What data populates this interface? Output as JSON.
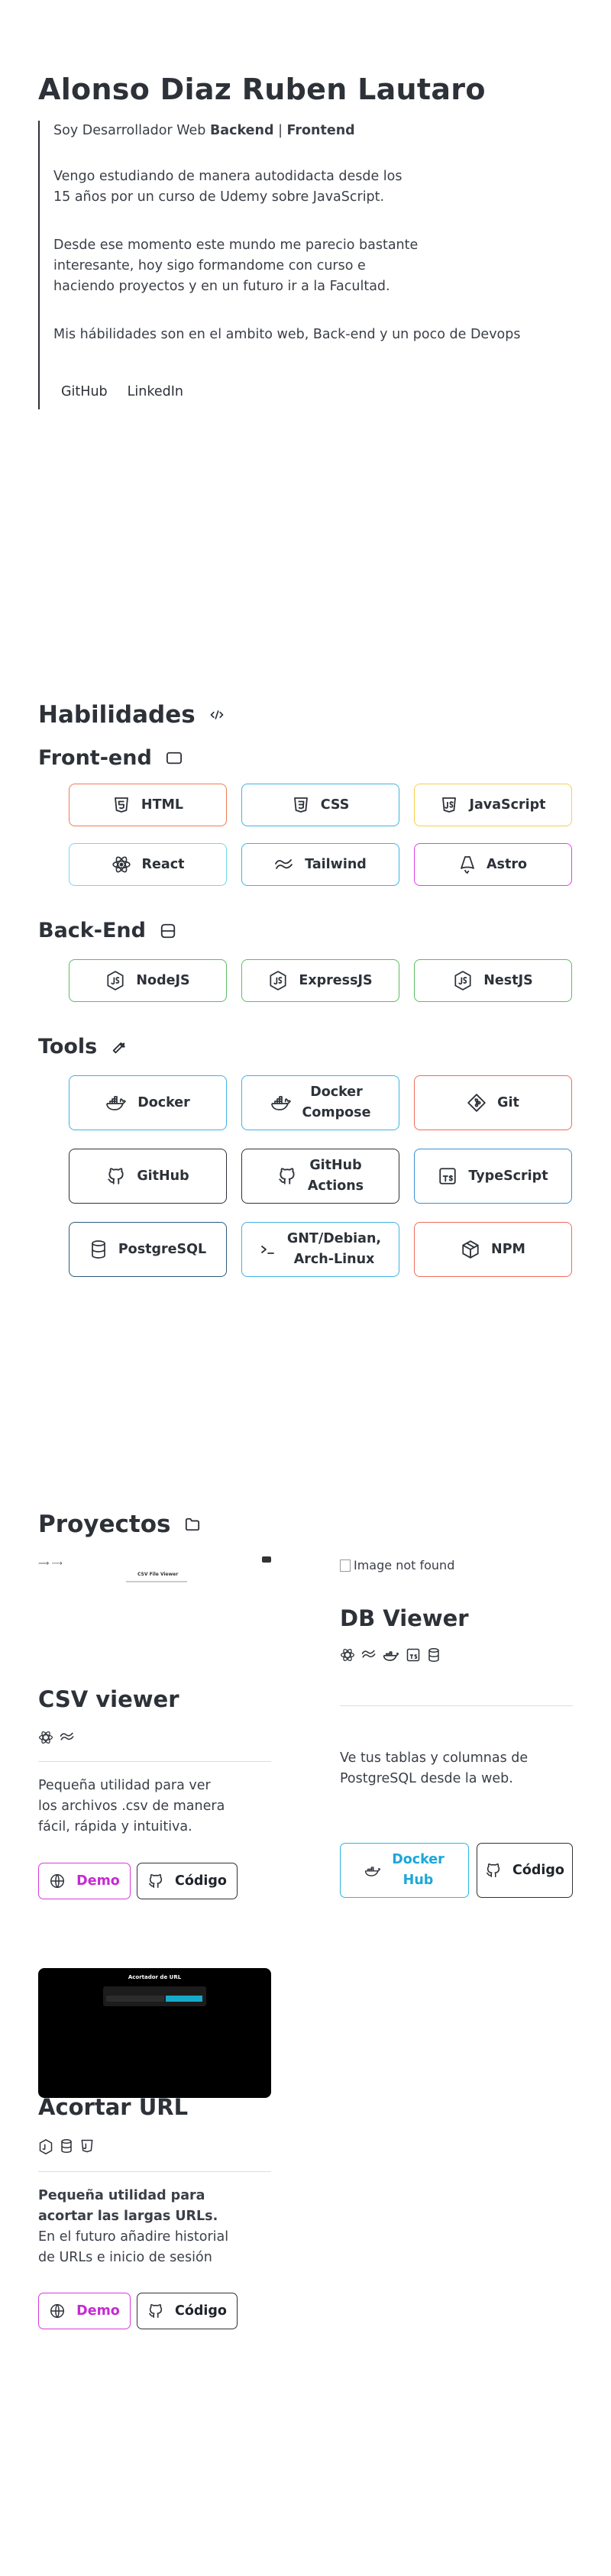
{
  "hero": {
    "name": "Alonso Diaz Ruben Lautaro",
    "intro_prefix": "Soy Desarrollador Web ",
    "intro_backend": "Backend",
    "intro_sep": " | ",
    "intro_frontend": "Frontend",
    "p1_line1": "Vengo estudiando de manera autodidacta desde los",
    "p1_line2": "15 años por un curso de Udemy sobre JavaScript.",
    "p2_line1": "Desde ese momento este mundo me parecio bastante",
    "p2_line2": "interesante, hoy sigo formandome con curso e",
    "p2_line3": "haciendo proyectos y en un futuro ir a la Facultad.",
    "p3": "Mis hábilidades son en el ambito web, Back-end y un poco de Devops",
    "link_github": "GitHub",
    "link_linkedin": "LinkedIn"
  },
  "skills": {
    "title": "Habilidades",
    "frontend_title": "Front-end",
    "frontend": [
      {
        "label": "HTML",
        "color": "#f27a52",
        "icon": "html5-icon"
      },
      {
        "label": "CSS",
        "color": "#3fb3e6",
        "icon": "css3-icon"
      },
      {
        "label": "JavaScript",
        "color": "#f5d04c",
        "icon": "javascript-icon"
      },
      {
        "label": "React",
        "color": "#6fdcea",
        "icon": "react-icon"
      },
      {
        "label": "Tailwind",
        "color": "#3fb3e6",
        "icon": "tailwind-icon"
      },
      {
        "label": "Astro",
        "color": "#e041e6",
        "icon": "astro-icon"
      }
    ],
    "backend_title": "Back-End",
    "backend": [
      {
        "label": "NodeJS",
        "color": "#5dbb63",
        "icon": "nodejs-icon"
      },
      {
        "label": "ExpressJS",
        "color": "#5dbb63",
        "icon": "nodejs-icon"
      },
      {
        "label": "NestJS",
        "color": "#5dbb63",
        "icon": "nodejs-icon"
      }
    ],
    "tools_title": "Tools",
    "tools": [
      {
        "label": "Docker",
        "color": "#3fb3e6",
        "icon": "docker-icon"
      },
      {
        "label_line1": "Docker",
        "label_line2": "Compose",
        "color": "#3fb3e6",
        "icon": "docker-icon"
      },
      {
        "label": "Git",
        "color": "#f06a5c",
        "icon": "git-icon"
      },
      {
        "label": "GitHub",
        "color": "#2d3138",
        "icon": "github-icon"
      },
      {
        "label_line1": "GitHub",
        "label_line2": "Actions",
        "color": "#2d3138",
        "icon": "github-icon"
      },
      {
        "label": "TypeScript",
        "color": "#3a8fd1",
        "icon": "typescript-icon"
      },
      {
        "label": "PostgreSQL",
        "color": "#2d5a7a",
        "icon": "database-icon"
      },
      {
        "label_line1": "GNT/Debian,",
        "label_line2": "Arch-Linux",
        "color": "#3fb3e6",
        "icon": "terminal-icon"
      },
      {
        "label": "NPM",
        "color": "#f06a5c",
        "icon": "package-icon"
      }
    ]
  },
  "projects": {
    "title": "Proyectos",
    "csv": {
      "title": "CSV viewer",
      "preview_title": "CSV File Viewer",
      "desc_line1": "Pequeña utilidad para ver",
      "desc_line2": "los archivos .csv de manera",
      "desc_line3": "fácil, rápida y intuitiva.",
      "demo": "Demo",
      "code": "Código"
    },
    "db": {
      "image_alt": "Image not found",
      "title": "DB Viewer",
      "desc_line1": "Ve tus tablas y columnas de",
      "desc_line2": "PostgreSQL desde la web.",
      "docker_line1": "Docker",
      "docker_line2": "Hub",
      "code": "Código"
    },
    "url": {
      "title": "Acortar URL",
      "preview_title": "Acortador de URL",
      "desc_bold_line1": "Pequeña utilidad para",
      "desc_bold_line2": "acortar las largas URLs.",
      "desc_line3": "En el futuro añadire historial",
      "desc_line4": "de URLs e inicio de sesión",
      "demo": "Demo",
      "code": "Código"
    }
  },
  "colors": {
    "text": "#2d3138",
    "demo": "#d63bd8",
    "docker": "#2ab7e0"
  }
}
